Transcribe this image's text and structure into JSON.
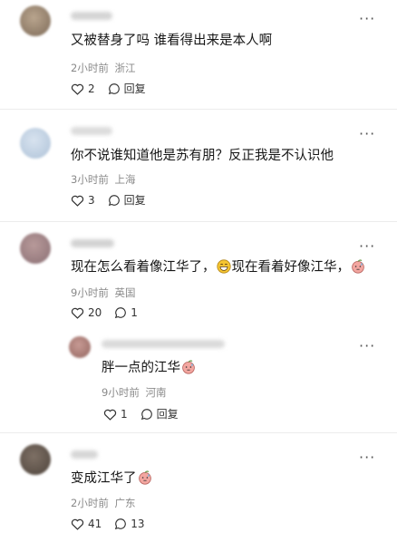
{
  "comments": [
    {
      "text": "又被替身了吗 谁看得出来是本人啊",
      "time": "2小时前",
      "location": "浙江",
      "likes": "2",
      "reply_label": "回复"
    },
    {
      "text": "你不说谁知道他是苏有朋？反正我是不认识他",
      "time": "3小时前",
      "location": "上海",
      "likes": "3",
      "reply_label": "回复"
    },
    {
      "text_a": "现在怎么看着像江华了，",
      "text_b": "现在看着好像江华，",
      "time": "9小时前",
      "location": "英国",
      "likes": "20",
      "replies": "1"
    },
    {
      "text": "胖一点的江华",
      "time": "9小时前",
      "location": "河南",
      "likes": "1",
      "reply_label": "回复"
    },
    {
      "text": "变成江华了",
      "time": "2小时前",
      "location": "广东",
      "likes": "41",
      "replies": "13"
    }
  ],
  "icons": [
    "heart-icon",
    "comment-icon",
    "more-icon",
    "grin-emoji",
    "sweat-peach-emoji"
  ]
}
